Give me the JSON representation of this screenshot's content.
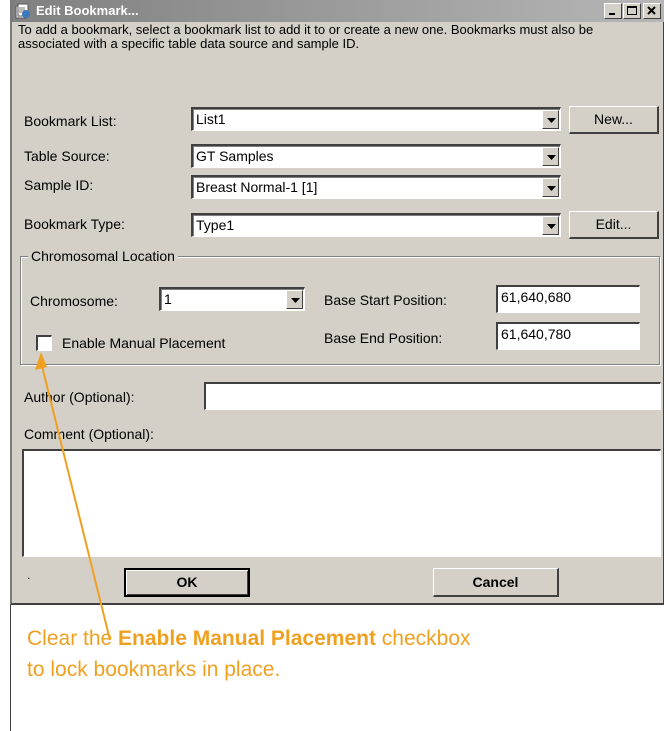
{
  "window": {
    "title": "Edit Bookmark...",
    "icon": "bookmark-app-icon"
  },
  "info_text": "To add a bookmark, select a bookmark list to add it to or create a new one. Bookmarks must also be associated with a specific table data source and sample ID.",
  "form": {
    "bookmark_list": {
      "label": "Bookmark List:",
      "value": "List1",
      "button": "New..."
    },
    "table_source": {
      "label": "Table Source:",
      "value": "GT Samples"
    },
    "sample_id": {
      "label": "Sample ID:",
      "value": "Breast Normal-1 [1]"
    },
    "bookmark_type": {
      "label": "Bookmark Type:",
      "value": "Type1",
      "button": "Edit..."
    }
  },
  "chromosomal_location": {
    "legend": "Chromosomal Location",
    "chromosome_label": "Chromosome:",
    "chromosome_value": "1",
    "base_start_label": "Base Start Position:",
    "base_start_value": "61,640,680",
    "base_end_label": "Base End Position:",
    "base_end_value": "61,640,780",
    "manual_placement_label": "Enable Manual Placement",
    "manual_placement_checked": false
  },
  "author": {
    "label": "Author (Optional):",
    "value": ""
  },
  "comment": {
    "label": "Comment (Optional):",
    "value": ""
  },
  "footer": {
    "dot": ".",
    "ok": "OK",
    "cancel": "Cancel"
  },
  "callout": {
    "prefix": "Clear the ",
    "emphasis": "Enable Manual Placement",
    "suffix": " checkbox",
    "line2": "to lock bookmarks in place.",
    "color": "#f0a020"
  }
}
